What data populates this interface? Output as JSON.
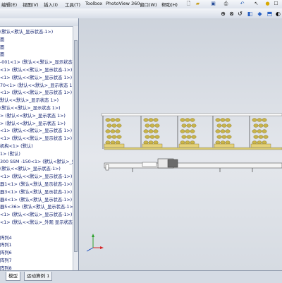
{
  "menus": [
    "编辑(E)",
    "视图(V)",
    "插入(I)",
    "工具(T)",
    "Toolbox",
    "PhotoView 360",
    "窗口(W)",
    "帮助(H)"
  ],
  "tree": {
    "rows": [
      "(默认<默认_显示状态-1>)",
      "面",
      "面",
      "面",
      "-001<1> (默认<<默认>_显示状态 1",
      "<1> (默认<<默认>_显示状态-1>)",
      "<1> (默认<<默认>_显示状态 1>)",
      "70<1> (默认<<默认>_显示状态 1>)",
      "<1> (默认<<默认>_显示状态 1>)",
      "默认<<默认>_显示状态 1>)",
      "(默认<<默认>_显示状态 1>)",
      "> (默认<<默认>_显示状态 1>)",
      "> (默认<<默认>_显示状态 1>)",
      "<1> (默认<<默认>_显示状态 1>)",
      "<1> (默认<<默认>_显示状态 1>)",
      "机构<1> (默认)",
      "1> (默认)",
      "300 SSM -150<1> (默认<默认>_外",
      "(默认<<默认>_显示状态-1>)",
      "<1> (默认<<默认>_显示状态-1>)",
      "器1<1> (默认<默认_显示状态-1>)",
      "器3<1> (默认<默认_显示状态-1>)",
      "器4<1> (默认<默认_显示状态-1>)",
      "器5<36> (默认<默认_显示状态-1>)",
      "<1> (默认<<默认>_显示状态-1>)",
      "<1> (默认<<默认>_外观 显示状态",
      "",
      "阵列4",
      "阵列1",
      "阵列6",
      "阵列7",
      "阵列8",
      "阵列10"
    ]
  },
  "tabs": [
    "模型",
    "运动算例 1"
  ],
  "colors": {
    "accent": "#1a5fb4",
    "tree_text": "#0a1a6a",
    "rack": "#c9b44a"
  }
}
